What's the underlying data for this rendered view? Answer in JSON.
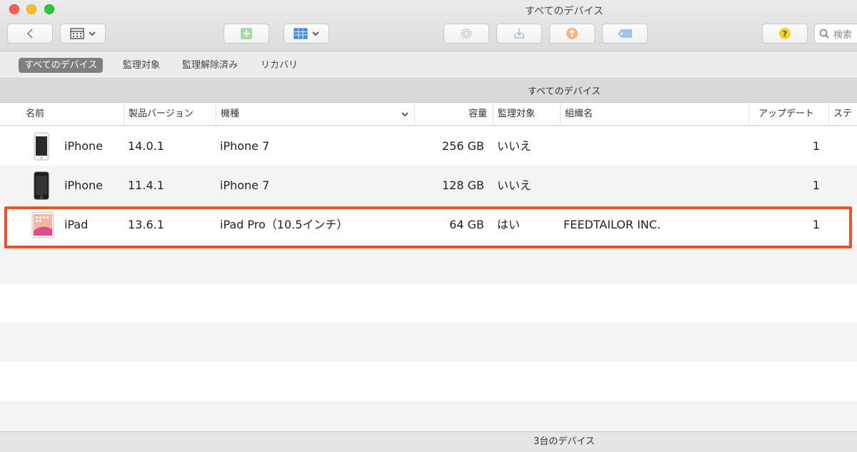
{
  "window": {
    "title": "すべてのデバイス"
  },
  "toolbar": {
    "search_placeholder": "検索",
    "colors": {
      "add": "#a7d9a4",
      "export": "#f5b383",
      "tag": "#9ec3f0",
      "help": "#f3d13a"
    }
  },
  "filters": [
    {
      "label": "すべてのデバイス",
      "active": true
    },
    {
      "label": "監理対象"
    },
    {
      "label": "監理解除済み"
    },
    {
      "label": "リカバリ"
    }
  ],
  "section": {
    "title": "すべてのデバイス"
  },
  "columns": {
    "name": "名前",
    "version": "製品バージョン",
    "model": "機種",
    "capacity": "容量",
    "supervised": "監理対象",
    "org": "組織名",
    "updates": "アップデート",
    "status": "ステ"
  },
  "devices": [
    {
      "name": "iPhone",
      "version": "14.0.1",
      "model": "iPhone 7",
      "capacity": "256 GB",
      "supervised": "いいえ",
      "org": "",
      "updates": "1"
    },
    {
      "name": "iPhone",
      "version": "11.4.1",
      "model": "iPhone 7",
      "capacity": "128 GB",
      "supervised": "いいえ",
      "org": "",
      "updates": "1"
    },
    {
      "name": "iPad",
      "version": "13.6.1",
      "model": "iPad Pro（10.5インチ）",
      "capacity": "64 GB",
      "supervised": "はい",
      "org": "FEEDTAILOR INC.",
      "updates": "1"
    }
  ],
  "footer": {
    "count": "3台のデバイス"
  }
}
